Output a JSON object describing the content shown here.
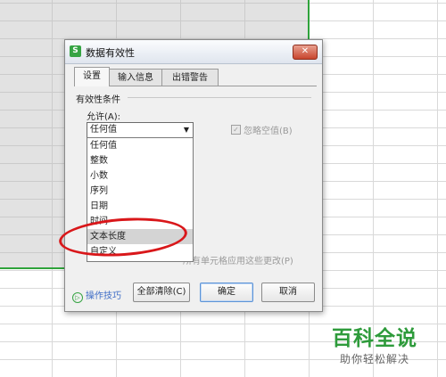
{
  "dialog": {
    "title": "数据有效性",
    "app_icon_letter": "S",
    "close_symbol": "✕",
    "tabs": [
      {
        "label": "设置",
        "active": true
      },
      {
        "label": "输入信息",
        "active": false
      },
      {
        "label": "出错警告",
        "active": false
      }
    ],
    "section_label": "有效性条件",
    "allow_label": "允许(A):",
    "allow_selected": "任何值",
    "ignore_blank_label": "忽略空值(B)",
    "ignore_blank_checked": true,
    "apply_all_label": "所有单元格应用这些更改(P)",
    "dropdown_options": [
      {
        "label": "任何值",
        "highlighted": false
      },
      {
        "label": "整数",
        "highlighted": false
      },
      {
        "label": "小数",
        "highlighted": false
      },
      {
        "label": "序列",
        "highlighted": false
      },
      {
        "label": "日期",
        "highlighted": false
      },
      {
        "label": "时间",
        "highlighted": false
      },
      {
        "label": "文本长度",
        "highlighted": true
      },
      {
        "label": "自定义",
        "highlighted": false
      }
    ],
    "tips_label": "操作技巧",
    "clear_all_label": "全部清除(C)",
    "ok_label": "确定",
    "cancel_label": "取消"
  },
  "icons": {
    "dropdown_arrow": "▼",
    "checkbox_mark": "✓",
    "tips_icon": "▷"
  },
  "colors": {
    "selection_border": "#2fa33b",
    "annotation_red": "#d9171a",
    "watermark_green": "#2e9b3b",
    "link_blue": "#3d6cc6"
  },
  "watermark": {
    "title": "百科全说",
    "subtitle": "助你轻松解决"
  }
}
